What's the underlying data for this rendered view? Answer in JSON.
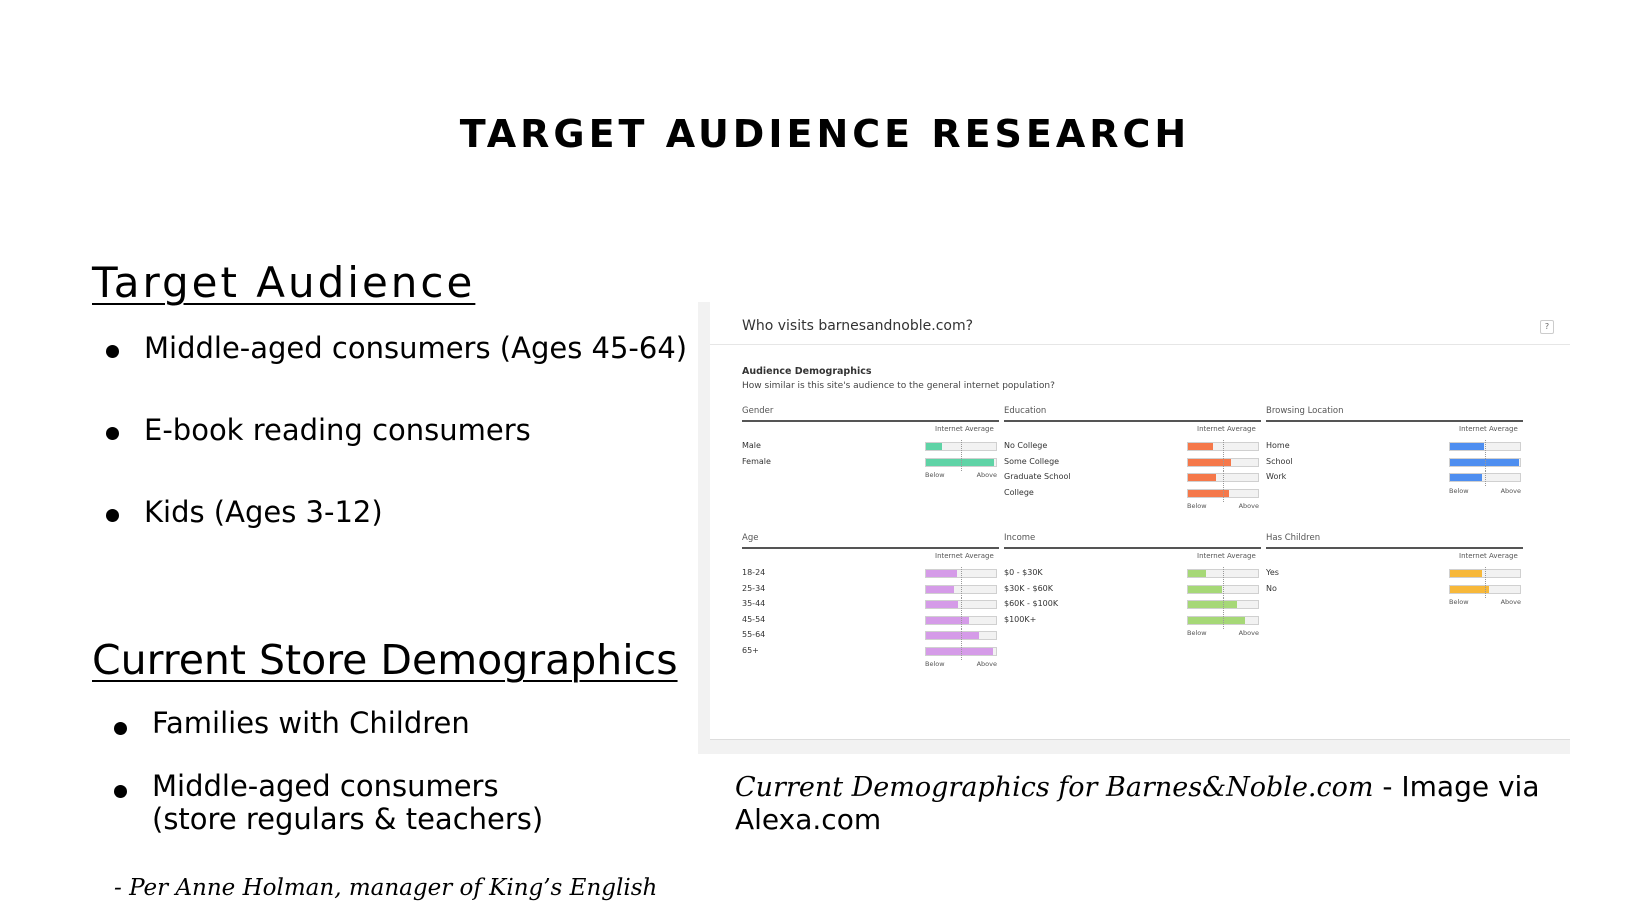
{
  "slide": {
    "title": "TARGET AUDIENCE RESEARCH",
    "target_heading": "Target Audience",
    "target_bullets": [
      "Middle-aged consumers (Ages 45-64)",
      "E-book reading consumers",
      "Kids (Ages 3-12)"
    ],
    "current_heading": "Current Store Demographics",
    "current_bullets": [
      "Families with Children",
      "Middle-aged consumers",
      "(store regulars & teachers)"
    ],
    "quote": "- Per Anne Holman, manager of King’s English",
    "caption_italic": "Current Demographics for Barnes&Noble.com",
    "caption_rest": " - Image via Alexa.com"
  },
  "screenshot": {
    "widget_title": "Who visits barnesandnoble.com?",
    "help_label": "?",
    "section_title": "Audience Demographics",
    "section_subtitle": "How similar is this site's audience to the general internet population?",
    "internet_average_label": "Internet Average",
    "below_label": "Below",
    "above_label": "Above",
    "panels": [
      {
        "title": "Gender",
        "color": "#5fd3a6",
        "rows": [
          {
            "label": "Male",
            "value": 0.23
          },
          {
            "label": "Female",
            "value": 0.97
          }
        ]
      },
      {
        "title": "Education",
        "color": "#f5784a",
        "rows": [
          {
            "label": "No College",
            "value": 0.36
          },
          {
            "label": "Some College",
            "value": 0.62
          },
          {
            "label": "Graduate School",
            "value": 0.4
          },
          {
            "label": "College",
            "value": 0.58
          }
        ]
      },
      {
        "title": "Browsing Location",
        "color": "#4e8ef0",
        "rows": [
          {
            "label": "Home",
            "value": 0.48
          },
          {
            "label": "School",
            "value": 0.98
          },
          {
            "label": "Work",
            "value": 0.46
          }
        ]
      },
      {
        "title": "Age",
        "color": "#d59be8",
        "rows": [
          {
            "label": "18-24",
            "value": 0.44
          },
          {
            "label": "25-34",
            "value": 0.4
          },
          {
            "label": "35-44",
            "value": 0.46
          },
          {
            "label": "45-54",
            "value": 0.62
          },
          {
            "label": "55-64",
            "value": 0.76
          },
          {
            "label": "65+",
            "value": 0.95
          }
        ]
      },
      {
        "title": "Income",
        "color": "#a6d877",
        "rows": [
          {
            "label": "$0 - $30K",
            "value": 0.26
          },
          {
            "label": "$30K - $60K",
            "value": 0.48
          },
          {
            "label": "$60K - $100K",
            "value": 0.7
          },
          {
            "label": "$100K+",
            "value": 0.82
          }
        ]
      },
      {
        "title": "Has Children",
        "color": "#f7b83a",
        "rows": [
          {
            "label": "Yes",
            "value": 0.46
          },
          {
            "label": "No",
            "value": 0.56
          }
        ]
      }
    ]
  }
}
